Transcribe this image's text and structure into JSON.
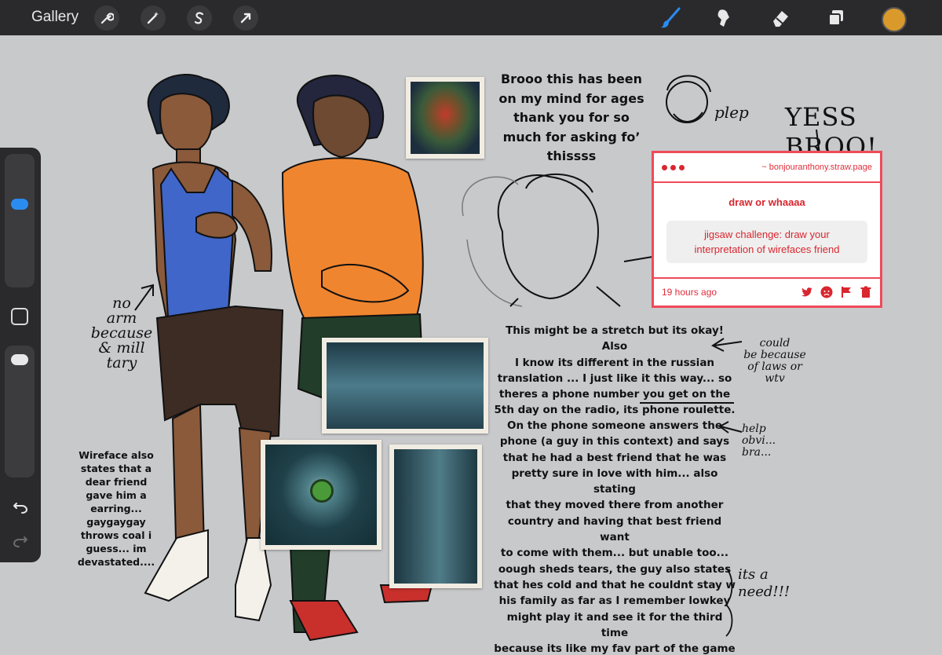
{
  "toolbar": {
    "gallery_label": "Gallery",
    "left_tools": [
      "wrench-icon",
      "magic-wand-icon",
      "selection-icon",
      "transform-arrow-icon"
    ],
    "right_tools": [
      "brush-icon",
      "smudge-icon",
      "eraser-icon",
      "layers-icon"
    ],
    "active_color": "#d99a2b",
    "brush_active_color": "#2b8cf0"
  },
  "sidebar": {
    "size_slider_level": 0.65,
    "opacity_slider_level": 0.05
  },
  "notes": {
    "message_lines": [
      "Brooo this has been",
      "on my mind for ages",
      "thank you for so",
      "much for asking fo’",
      "thissss"
    ],
    "plep": "plep",
    "yess_broo": "YESS BROO!",
    "no_arm_lines": [
      "no",
      "arm",
      "because",
      "& mill",
      "tary"
    ],
    "wireface_lines": [
      "Wireface also",
      "states that a",
      "dear friend",
      "gave him a",
      "earring...",
      "gaygaygay",
      "throws coal i",
      "guess... im",
      "devastated...."
    ],
    "stretch_lines": [
      "This might be a stretch but its okay! Also",
      "I know its different in the russian",
      "translation ... I just like it this way... so",
      "theres a phone number you get on the",
      "5th day on the radio, its phone roulette."
    ],
    "could_be_lines": [
      "could",
      "be because",
      "of laws or",
      "wtv"
    ],
    "phone_lines": [
      "On the phone someone answers the",
      "phone (a guy in this context) and says",
      "that he had a best friend that he was",
      "pretty sure in love with him... also stating",
      "that they moved there from another",
      "country and having that best friend want",
      "to come with them... but unable too...",
      "oough sheds tears, the guy also states",
      "that hes cold and that he couldnt stay w",
      "his family as far as I remember lowkey",
      "might play it and see it for the third time",
      "because its like my fav part of the game"
    ],
    "help_lines": [
      "help",
      "obvi...",
      "bra..."
    ],
    "its_a_need_lines": [
      "its a",
      "need!!!"
    ]
  },
  "straw_panel": {
    "url": "~ bonjouranthony.straw.page",
    "title": "draw or whaaaa",
    "message_lines": [
      "jigsaw challenge: draw your",
      "interpretation of wirefaces friend"
    ],
    "time": "19 hours ago",
    "icons": [
      "twitter-icon",
      "angry-face-icon",
      "flag-icon",
      "trash-icon"
    ]
  }
}
